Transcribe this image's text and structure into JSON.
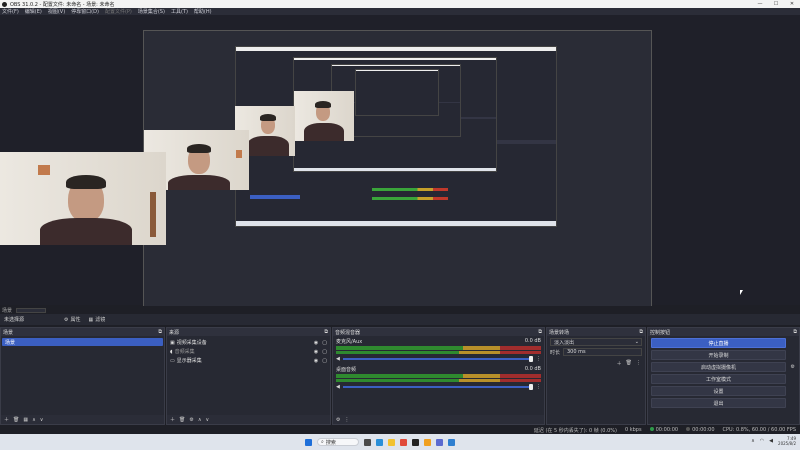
{
  "window": {
    "title": "OBS 31.0.2 - 配置文件: 未命名 - 场景: 未命名",
    "min": "—",
    "max": "☐",
    "close": "✕"
  },
  "menu": {
    "items": [
      "文件(F)",
      "编辑(E)",
      "视图(V)",
      "停靠窗口(D)",
      "配置文件(P)",
      "场景集合(S)",
      "工具(T)",
      "帮助(H)"
    ]
  },
  "scene_controls": {
    "label": "场景",
    "current_scene": "未选择源",
    "properties": "属性",
    "filters": "滤镜"
  },
  "docks": {
    "scenes": {
      "title": "场景",
      "items": [
        "场景"
      ]
    },
    "sources": {
      "title": "来源",
      "items": [
        {
          "icon": "camera",
          "name": "视频采集设备"
        },
        {
          "icon": "speaker",
          "name": "音频采集"
        },
        {
          "icon": "monitor",
          "name": "显示器采集"
        }
      ]
    },
    "mixer": {
      "title": "音频混音器",
      "channels": [
        {
          "name": "麦克风/Aux",
          "db": "0.0 dB"
        },
        {
          "name": "桌面音频",
          "db": "0.0 dB"
        }
      ]
    },
    "transitions": {
      "title": "场景转场",
      "selected": "淡入淡出",
      "duration_label": "时长",
      "duration": "300 ms"
    },
    "controls": {
      "title": "控制按钮",
      "buttons": [
        "停止直播",
        "开始录制",
        "启动虚拟摄像机",
        "工作室模式",
        "设置",
        "退出"
      ]
    }
  },
  "status": {
    "bitrate": "延迟 (在 5 秒内丢失了): 0 帧 (0.0%)",
    "kbps": "0 kbps",
    "live_time": "00:00:00",
    "rec_time": "00:00:00",
    "cpu": "CPU: 0.8%, 60.00 / 60.00 FPS"
  },
  "taskbar": {
    "search": "搜索",
    "time": "7:49",
    "date": "2025/8/2"
  }
}
